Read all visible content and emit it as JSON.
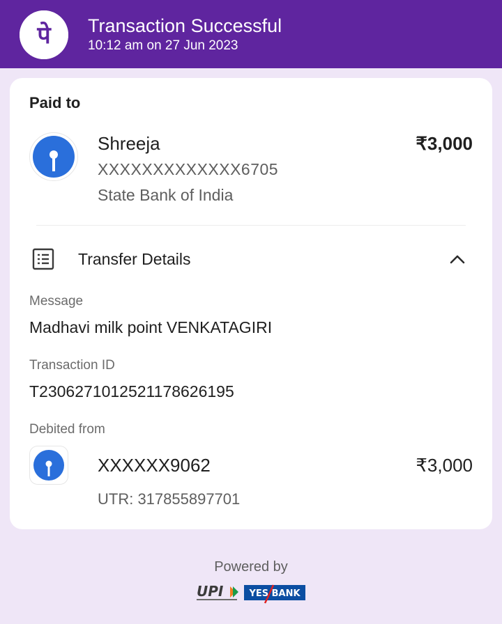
{
  "header": {
    "title": "Transaction Successful",
    "datetime": "10:12 am on 27 Jun 2023",
    "app_logo_icon": "phonepe-logo-icon",
    "logo_glyph": "पे",
    "background_color": "#5f259f"
  },
  "payee": {
    "section_label": "Paid to",
    "name": "Shreeja",
    "account": "XXXXXXXXXXXXX6705",
    "bank": "State Bank of India",
    "amount": "₹3,000",
    "bank_logo_icon": "sbi-logo-icon"
  },
  "transfer_details": {
    "title": "Transfer Details",
    "icon": "receipt-list-icon",
    "toggle_icon": "chevron-up-icon",
    "expanded": true,
    "message_label": "Message",
    "message": "Madhavi milk point VENKATAGIRI",
    "transaction_id_label": "Transaction ID",
    "transaction_id": "T2306271012521178626195",
    "debited_from_label": "Debited from",
    "debit_account": "XXXXXX9062",
    "debit_amount": "₹3,000",
    "utr": "UTR: 317855897701",
    "bank_logo_icon": "sbi-logo-icon"
  },
  "footer": {
    "powered_by": "Powered by",
    "upi_logo_text": "UPI",
    "yes_bank_logo_text": "YES BANK"
  },
  "colors": {
    "brand_purple": "#5f259f",
    "page_background": "#efe6f7",
    "sbi_blue": "#2a6fdb"
  }
}
